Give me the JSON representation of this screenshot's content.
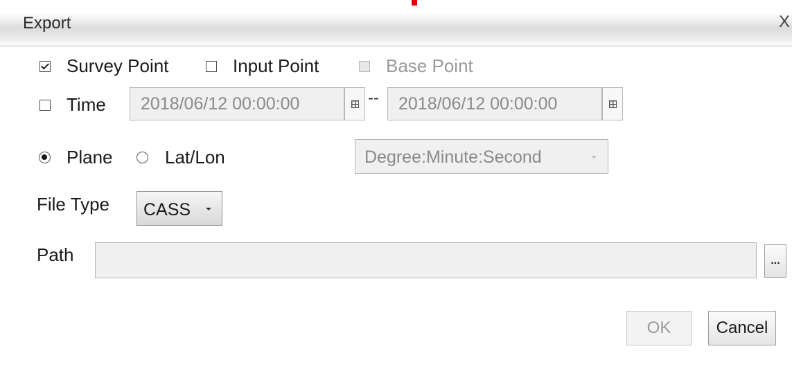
{
  "window": {
    "title": "Export",
    "close_label": "X"
  },
  "point_types": {
    "survey_point": {
      "label": "Survey Point",
      "checked": true
    },
    "input_point": {
      "label": "Input Point",
      "checked": false
    },
    "base_point": {
      "label": "Base Point",
      "checked": false,
      "enabled": false
    }
  },
  "time": {
    "label": "Time",
    "checked": false,
    "start_value": "2018/06/12 00:00:00",
    "separator": "--",
    "end_value": "2018/06/12 00:00:00"
  },
  "coordinates": {
    "plane_label": "Plane",
    "latlon_label": "Lat/Lon",
    "selected": "Plane",
    "format_value": "Degree:Minute:Second"
  },
  "file_type": {
    "label": "File Type",
    "value": "CASS"
  },
  "path": {
    "label": "Path",
    "value": "",
    "browse_label": "..."
  },
  "buttons": {
    "ok_label": "OK",
    "cancel_label": "Cancel"
  }
}
